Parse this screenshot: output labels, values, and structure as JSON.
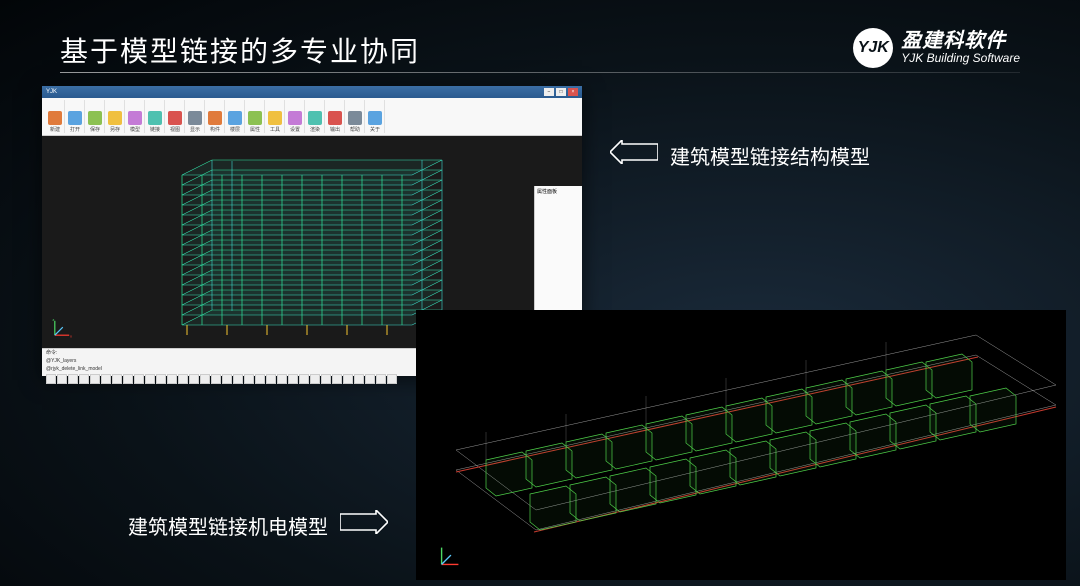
{
  "title": "基于模型链接的多专业协同",
  "brand": {
    "logo_text": "YJK",
    "name_cn": "盈建科软件",
    "name_en": "YJK Building Software"
  },
  "callouts": {
    "structural": "建筑模型链接结构模型",
    "mep": "建筑模型链接机电模型"
  },
  "cad": {
    "title": "YJK",
    "ribbon_groups": [
      "新建",
      "打开",
      "保存",
      "另存",
      "模型",
      "链接",
      "视图",
      "显示",
      "构件",
      "楼层",
      "属性",
      "工具",
      "设置",
      "渲染",
      "输出",
      "帮助",
      "关于"
    ],
    "side_panel_title": "属性面板",
    "status_lines": [
      "命令:",
      "@YJK_layers",
      "@rjyk_delete_link_model"
    ],
    "status_icon_count": 32
  },
  "axes": {
    "x": "x",
    "y": "y",
    "z": "z"
  },
  "colors": {
    "accent_green": "#2ee89a",
    "accent_cyan": "#3fd9d0",
    "wire_green": "#4fd14a",
    "wire_red": "#c63a2e",
    "wire_white": "#bfbfbf"
  }
}
